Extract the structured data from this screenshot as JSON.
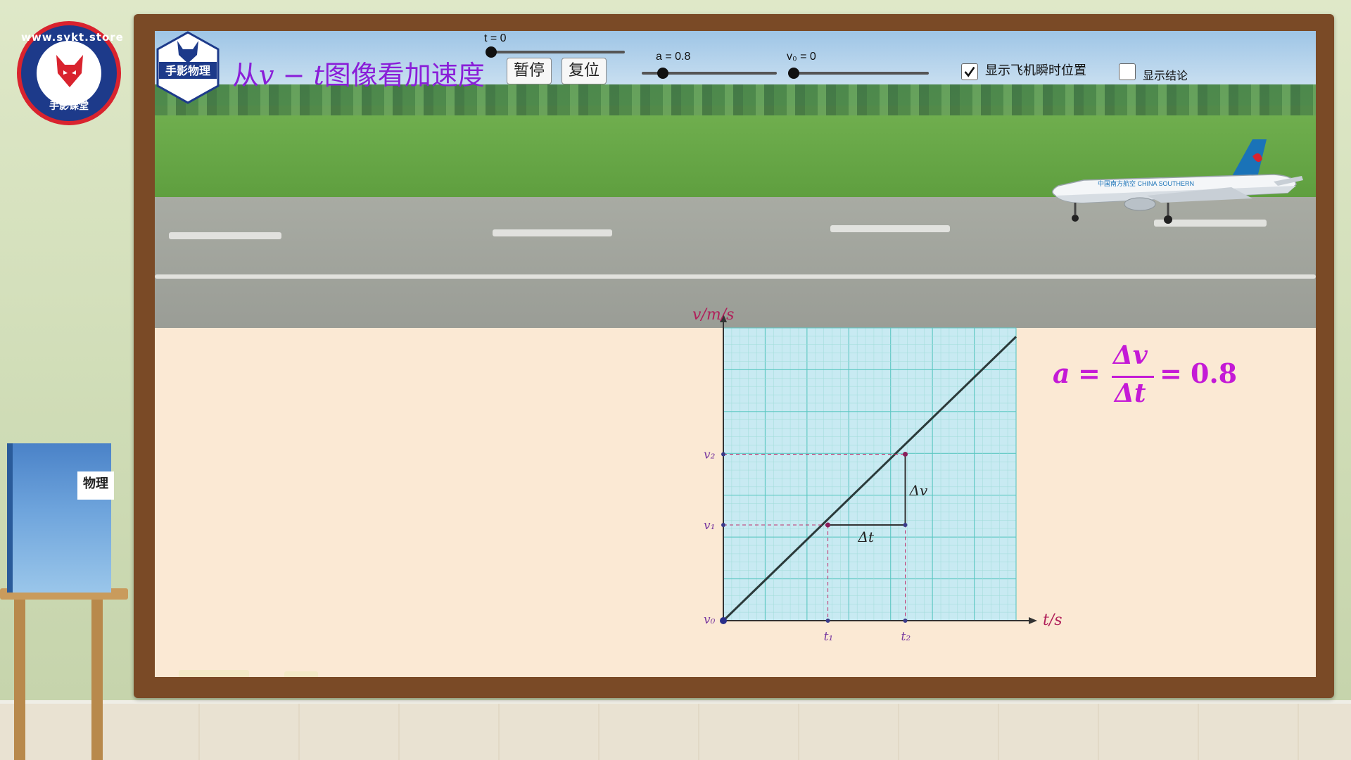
{
  "logo": {
    "ring_text": "www.sykt.store",
    "bottom_text": "手影课堂"
  },
  "book": {
    "title": "物理"
  },
  "header": {
    "badge_text": "手影物理",
    "title_prefix": "从",
    "title_v": "v",
    "title_dash": " − ",
    "title_t": "t",
    "title_suffix": "图像看加速度",
    "pause_label": "暂停",
    "reset_label": "复位"
  },
  "sliders": {
    "t": {
      "label": "t = 0",
      "value": 0
    },
    "a": {
      "label": "a = 0.8",
      "value": 0.8
    },
    "v0": {
      "label": "v₀ = 0",
      "value": 0
    }
  },
  "checkboxes": {
    "show_position": {
      "label": "显示飞机瞬时位置",
      "checked": true
    },
    "show_conclusion": {
      "label": "显示结论",
      "checked": false
    }
  },
  "formula": {
    "lhs": "a",
    "numerator": "Δv",
    "denominator": "Δt",
    "result": "0.8"
  },
  "plane": {
    "livery_text": "中国南方航空 CHINA SOUTHERN"
  },
  "chart_data": {
    "type": "line",
    "xlabel": "t/s",
    "ylabel": "v/m/s",
    "x_ticks": [
      "t₁",
      "t₂"
    ],
    "y_ticks": [
      "v₀",
      "v₁",
      "v₂"
    ],
    "grid": true,
    "annotations": [
      "Δv",
      "Δt"
    ],
    "series": [
      {
        "x": [
          0,
          7
        ],
        "y": [
          0,
          5.6
        ]
      }
    ]
  },
  "colors": {
    "title": "#8a1ed8",
    "formula": "#c41ad6",
    "axis_label": "#b0205a",
    "grid_bg": "#c8eaf2",
    "grid_line": "#5cc7c2"
  }
}
